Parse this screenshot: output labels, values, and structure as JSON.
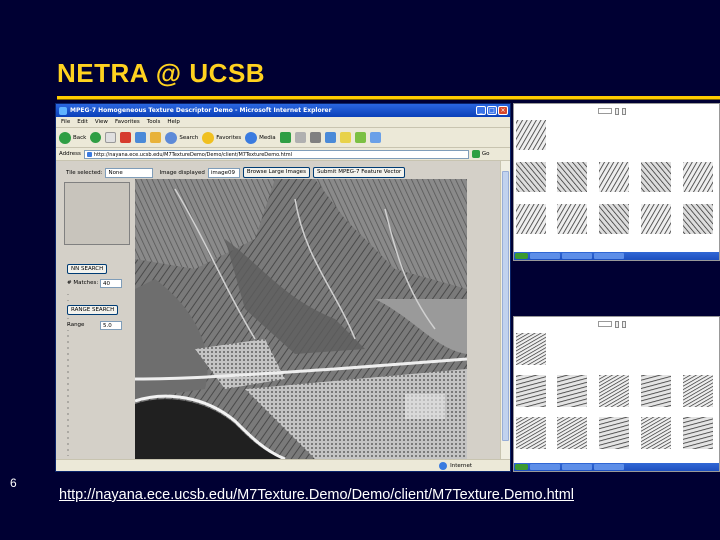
{
  "slide": {
    "title": "NETRA @ UCSB",
    "number": "6",
    "link": "http://nayana.ece.ucsb.edu/M7Texture.Demo/Demo/client/M7Texture.Demo.html"
  },
  "browser": {
    "window_title": "MPEG-7 Homogeneous Texture Descriptor Demo - Microsoft Internet Explorer",
    "menu": [
      "File",
      "Edit",
      "View",
      "Favorites",
      "Tools",
      "Help"
    ],
    "toolbar": {
      "back": "Back",
      "search": "Search",
      "favorites": "Favorites",
      "media": "Media"
    },
    "address_label": "Address",
    "address": "http://nayana.ece.ucsb.edu/M7TextureDemo/Demo/client/M7TextureDemo.html",
    "go": "Go",
    "status_zone": "Internet"
  },
  "demo": {
    "tile_selected_label": "Tile selected:",
    "tile_selected_value": "None",
    "image_displayed_label": "Image displayed",
    "image_displayed_value": "image09",
    "browse_button": "Browse Large Images",
    "submit_button": "Submit MPEG-7 Feature Vector",
    "nn_search_button": "NN SEARCH",
    "matches_label": "# Matches:",
    "matches_value": "40",
    "divider": "---------------------------",
    "range_search_button": "RANGE SEARCH",
    "range_label": "Range",
    "range_value": "5.0"
  }
}
